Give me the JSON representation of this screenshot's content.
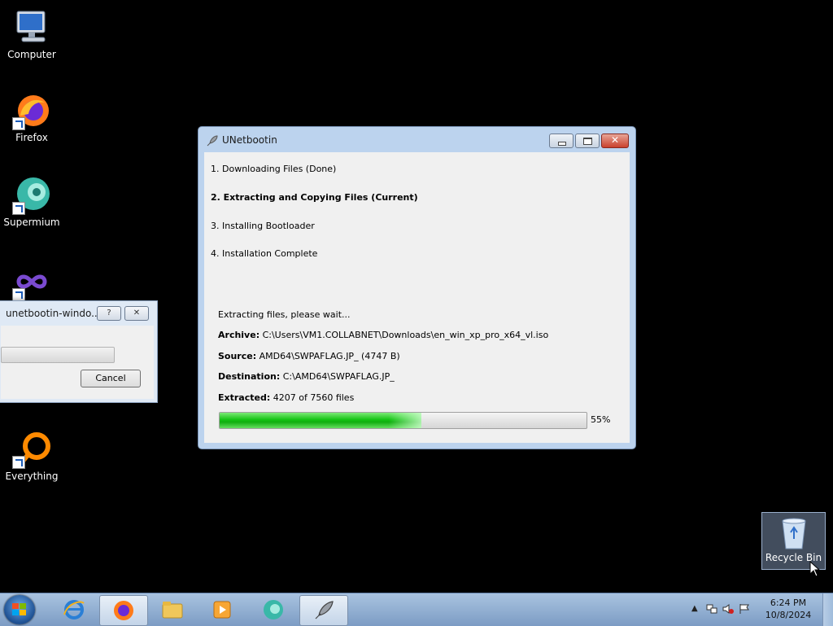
{
  "desktop": {
    "icons": [
      {
        "label": "Computer"
      },
      {
        "label": "Firefox"
      },
      {
        "label": "Supermium"
      },
      {
        "label": "Everything"
      }
    ],
    "recycle_bin": {
      "label": "Recycle Bin"
    }
  },
  "small_dialog": {
    "title": "unetbootin-windo...",
    "help_label": "?",
    "close_label": "✕",
    "cancel_label": "Cancel"
  },
  "main_window": {
    "title": "UNetbootin",
    "close_label": "✕",
    "steps": [
      {
        "label": "1. Downloading Files (Done)",
        "current": false
      },
      {
        "label": "2. Extracting and Copying Files (Current)",
        "current": true
      },
      {
        "label": "3. Installing Bootloader",
        "current": false
      },
      {
        "label": "4. Installation Complete",
        "current": false
      }
    ],
    "status_text": "Extracting files, please wait...",
    "archive_label": "Archive:",
    "archive_value": "C:\\Users\\VM1.COLLABNET\\Downloads\\en_win_xp_pro_x64_vl.iso",
    "source_label": "Source:",
    "source_value": "AMD64\\SWPAFLAG.JP_ (4747 B)",
    "destination_label": "Destination:",
    "destination_value": "C:\\AMD64\\SWPAFLAG.JP_",
    "extracted_label": "Extracted:",
    "extracted_value": "4207 of 7560 files",
    "progress_percent": 55,
    "progress_text": "55%"
  },
  "taskbar": {
    "apps": [
      "internet-explorer",
      "firefox",
      "file-explorer",
      "media-player",
      "supermium",
      "unetbootin"
    ],
    "clock_time": "6:24 PM",
    "clock_date": "10/8/2024"
  },
  "colors": {
    "desktop_bg": "#000000",
    "progress_fill": "#14c314",
    "window_frame": "#bcd3ee",
    "taskbar": "#a9c3e0"
  }
}
